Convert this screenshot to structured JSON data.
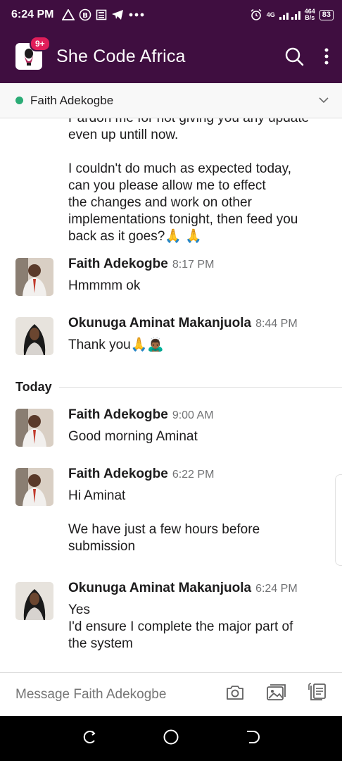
{
  "status_bar": {
    "time": "6:24 PM",
    "left_icons": [
      "triangle-warning-icon",
      "b-circle-icon",
      "news-icon",
      "telegram-icon",
      "more-dots-icon"
    ],
    "signal_label": "4G",
    "net_speed_value": "464",
    "net_speed_unit": "B/s",
    "battery": "83"
  },
  "header": {
    "workspace_name": "She Code Africa",
    "badge": "9+"
  },
  "channel": {
    "name": "Faith Adekogbe",
    "presence_color": "#2bac76"
  },
  "partial_message": {
    "cut_line": "Pardon me for not giving you any update",
    "line2": "even up untill now.",
    "para2_lines": [
      "I couldn't do much as expected today,",
      "can you please allow me to effect",
      "the changes and work on other",
      "implementations tonight, then feed you",
      "back as it goes?🙏 🙏"
    ]
  },
  "messages": [
    {
      "sender": "Faith Adekogbe",
      "time": "8:17 PM",
      "lines": [
        "Hmmmm ok"
      ]
    },
    {
      "sender": "Okunuga Aminat Makanjuola",
      "time": "8:44 PM",
      "lines": [
        "Thank you🙏🙇🏾‍♂️"
      ]
    },
    {
      "sender": "Faith Adekogbe",
      "time": "9:00 AM",
      "lines": [
        "Good morning Aminat"
      ]
    },
    {
      "sender": "Faith Adekogbe",
      "time": "6:22 PM",
      "lines": [
        "Hi Aminat",
        "",
        "We have just a few hours before",
        "submission"
      ]
    },
    {
      "sender": "Okunuga Aminat Makanjuola",
      "time": "6:24 PM",
      "lines": [
        "Yes",
        "I'd ensure I complete the major part of",
        "the system"
      ]
    }
  ],
  "day_divider": "Today",
  "composer": {
    "placeholder": "Message Faith Adekogbe"
  },
  "colors": {
    "header_bg": "#3f0e40",
    "badge": "#e01e5a",
    "presence": "#2bac76"
  }
}
